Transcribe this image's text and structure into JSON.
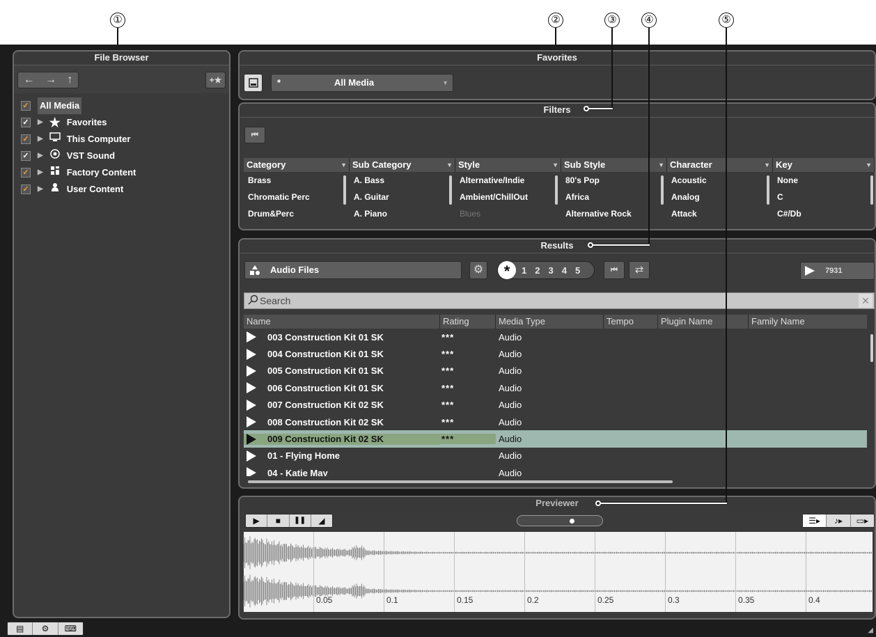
{
  "callouts": [
    "①",
    "②",
    "③",
    "④",
    "⑤"
  ],
  "file_browser": {
    "title": "File Browser",
    "nav": {
      "back": "←",
      "forward": "→",
      "up": "↑",
      "add_favorite": "+★"
    },
    "items": [
      {
        "label": "All Media",
        "icon": "none"
      },
      {
        "label": "Favorites",
        "icon": "star-icon"
      },
      {
        "label": "This Computer",
        "icon": "computer-icon"
      },
      {
        "label": "VST Sound",
        "icon": "vst-sound-icon"
      },
      {
        "label": "Factory Content",
        "icon": "factory-content-icon"
      },
      {
        "label": "User Content",
        "icon": "user-icon"
      }
    ]
  },
  "favorites": {
    "title": "Favorites",
    "selector_prefix": "*",
    "selector_value": "All Media"
  },
  "filters": {
    "title": "Filters",
    "columns": [
      {
        "header": "Category",
        "items": [
          "Brass",
          "Chromatic Perc",
          "Drum&Perc"
        ]
      },
      {
        "header": "Sub Category",
        "items": [
          "A. Bass",
          "A. Guitar",
          "A. Piano"
        ]
      },
      {
        "header": "Style",
        "items": [
          "Alternative/Indie",
          "Ambient/ChillOut",
          "Blues"
        ]
      },
      {
        "header": "Sub Style",
        "items": [
          "80's Pop",
          "Africa",
          "Alternative Rock"
        ]
      },
      {
        "header": "Character",
        "items": [
          "Acoustic",
          "Analog",
          "Attack"
        ]
      },
      {
        "header": "Key",
        "items": [
          "None",
          "C",
          "C#/Db"
        ]
      }
    ]
  },
  "results": {
    "title": "Results",
    "media_type": "Audio Files",
    "rating_star": "*",
    "rating_levels": [
      "1",
      "2",
      "3",
      "4",
      "5"
    ],
    "count": "7931",
    "search_placeholder": "Search",
    "columns": [
      "Name",
      "Rating",
      "Media Type",
      "Tempo",
      "Plugin Name",
      "Family Name"
    ],
    "rows": [
      {
        "name": "003 Construction Kit 01 SK",
        "rating": "***",
        "media": "Audio"
      },
      {
        "name": "004 Construction Kit 01 SK",
        "rating": "***",
        "media": "Audio"
      },
      {
        "name": "005 Construction Kit 01 SK",
        "rating": "***",
        "media": "Audio"
      },
      {
        "name": "006 Construction Kit 01 SK",
        "rating": "***",
        "media": "Audio"
      },
      {
        "name": "007 Construction Kit 02 SK",
        "rating": "***",
        "media": "Audio"
      },
      {
        "name": "008 Construction Kit 02 SK",
        "rating": "***",
        "media": "Audio"
      },
      {
        "name": "009 Construction Kit 02 SK",
        "rating": "***",
        "media": "Audio"
      },
      {
        "name": "01 - Flying Home",
        "rating": "",
        "media": "Audio"
      },
      {
        "name": "04 - Katie May",
        "rating": "",
        "media": "Audio"
      }
    ],
    "selected_index": 6
  },
  "previewer": {
    "title": "Previewer",
    "timeline": [
      "0.05",
      "0.1",
      "0.15",
      "0.2",
      "0.25",
      "0.3",
      "0.35",
      "0.4"
    ],
    "volume_level": 0.65
  },
  "colors": {
    "accent_orange": "#f0a030",
    "selected_row": "#9eb8b0",
    "selected_name": "#8aa680"
  }
}
